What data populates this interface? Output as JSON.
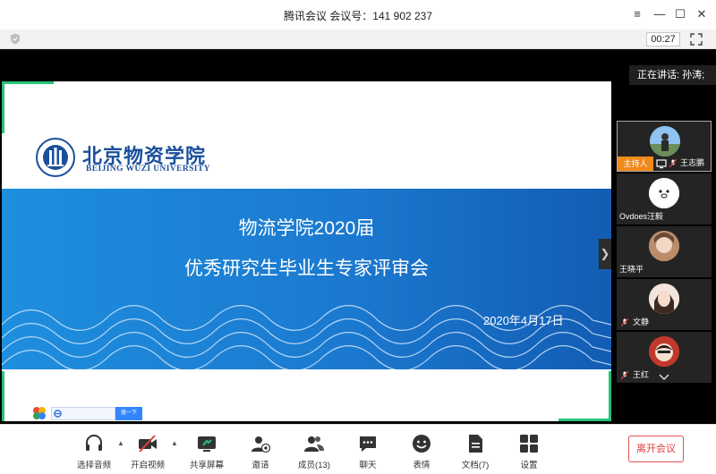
{
  "window": {
    "title": "腾讯会议 会议号：141 902 237"
  },
  "window_controls": {
    "menu": "≡",
    "minimize": "—",
    "maximize": "☐",
    "close": "✕"
  },
  "toolstrip": {
    "timer": "00:27"
  },
  "slide": {
    "logo_cn": "北京物资学院",
    "logo_en": "BEIJING WUZI UNIVERSITY",
    "title_line1": "物流学院2020届",
    "title_line2": "优秀研究生毕业生专家评审会",
    "date": "2020年4月17日",
    "mini_search_button": "搜一下"
  },
  "speaking": {
    "label": "正在讲话: 孙涛;"
  },
  "participants": [
    {
      "name": "王志鹏",
      "role": "主持人"
    },
    {
      "name": "Ovdoes汪毅"
    },
    {
      "name": "王晓平"
    },
    {
      "name": "文静"
    },
    {
      "name": "王红"
    }
  ],
  "toolbar": {
    "audio": "选择音频",
    "video": "开启视频",
    "share": "共享屏幕",
    "invite": "邀请",
    "members": "成员(13)",
    "chat": "聊天",
    "emoji": "表情",
    "docs": "文档(7)",
    "settings": "设置",
    "leave": "离开会议"
  },
  "colors": {
    "accent_blue": "#1b7ad0",
    "host_orange": "#f08a1b",
    "leave_red": "#e03c3c",
    "speaker_green": "#27c37a"
  }
}
